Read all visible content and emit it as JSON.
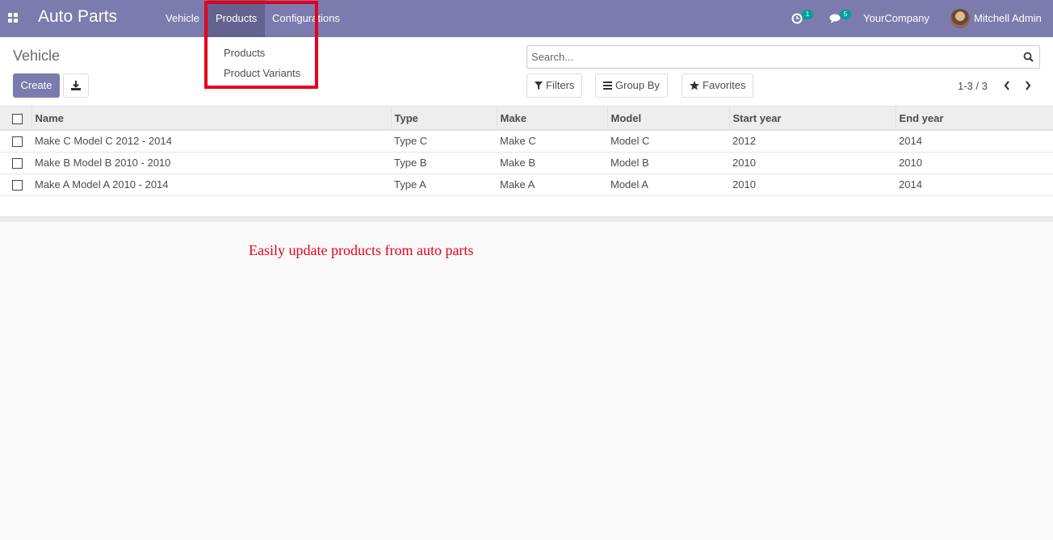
{
  "navbar": {
    "app_title": "Auto Parts",
    "menu": [
      "Vehicle",
      "Products",
      "Configurations"
    ],
    "active_menu": "Products",
    "activity_count": "1",
    "message_count": "5",
    "company": "YourCompany",
    "user": "Mitchell Admin"
  },
  "dropdown": {
    "items": [
      "Products",
      "Product Variants"
    ]
  },
  "control_panel": {
    "breadcrumb": "Vehicle",
    "create_label": "Create",
    "search_placeholder": "Search...",
    "filters_label": "Filters",
    "groupby_label": "Group By",
    "favorites_label": "Favorites",
    "pager": "1-3 / 3"
  },
  "table": {
    "columns": [
      "Name",
      "Type",
      "Make",
      "Model",
      "Start year",
      "End year"
    ],
    "rows": [
      [
        "Make C Model C 2012 - 2014",
        "Type C",
        "Make C",
        "Model C",
        "2012",
        "2014"
      ],
      [
        "Make B Model B 2010 - 2010",
        "Type B",
        "Make B",
        "Model B",
        "2010",
        "2010"
      ],
      [
        "Make A Model A 2010 - 2014",
        "Type A",
        "Make A",
        "Model A",
        "2010",
        "2014"
      ]
    ]
  },
  "annotation": "Easily update products from auto parts",
  "colors": {
    "navbar": "#7c7bad",
    "active_menu": "#64638f",
    "highlight": "#e5001c",
    "badge": "#00a09d"
  }
}
